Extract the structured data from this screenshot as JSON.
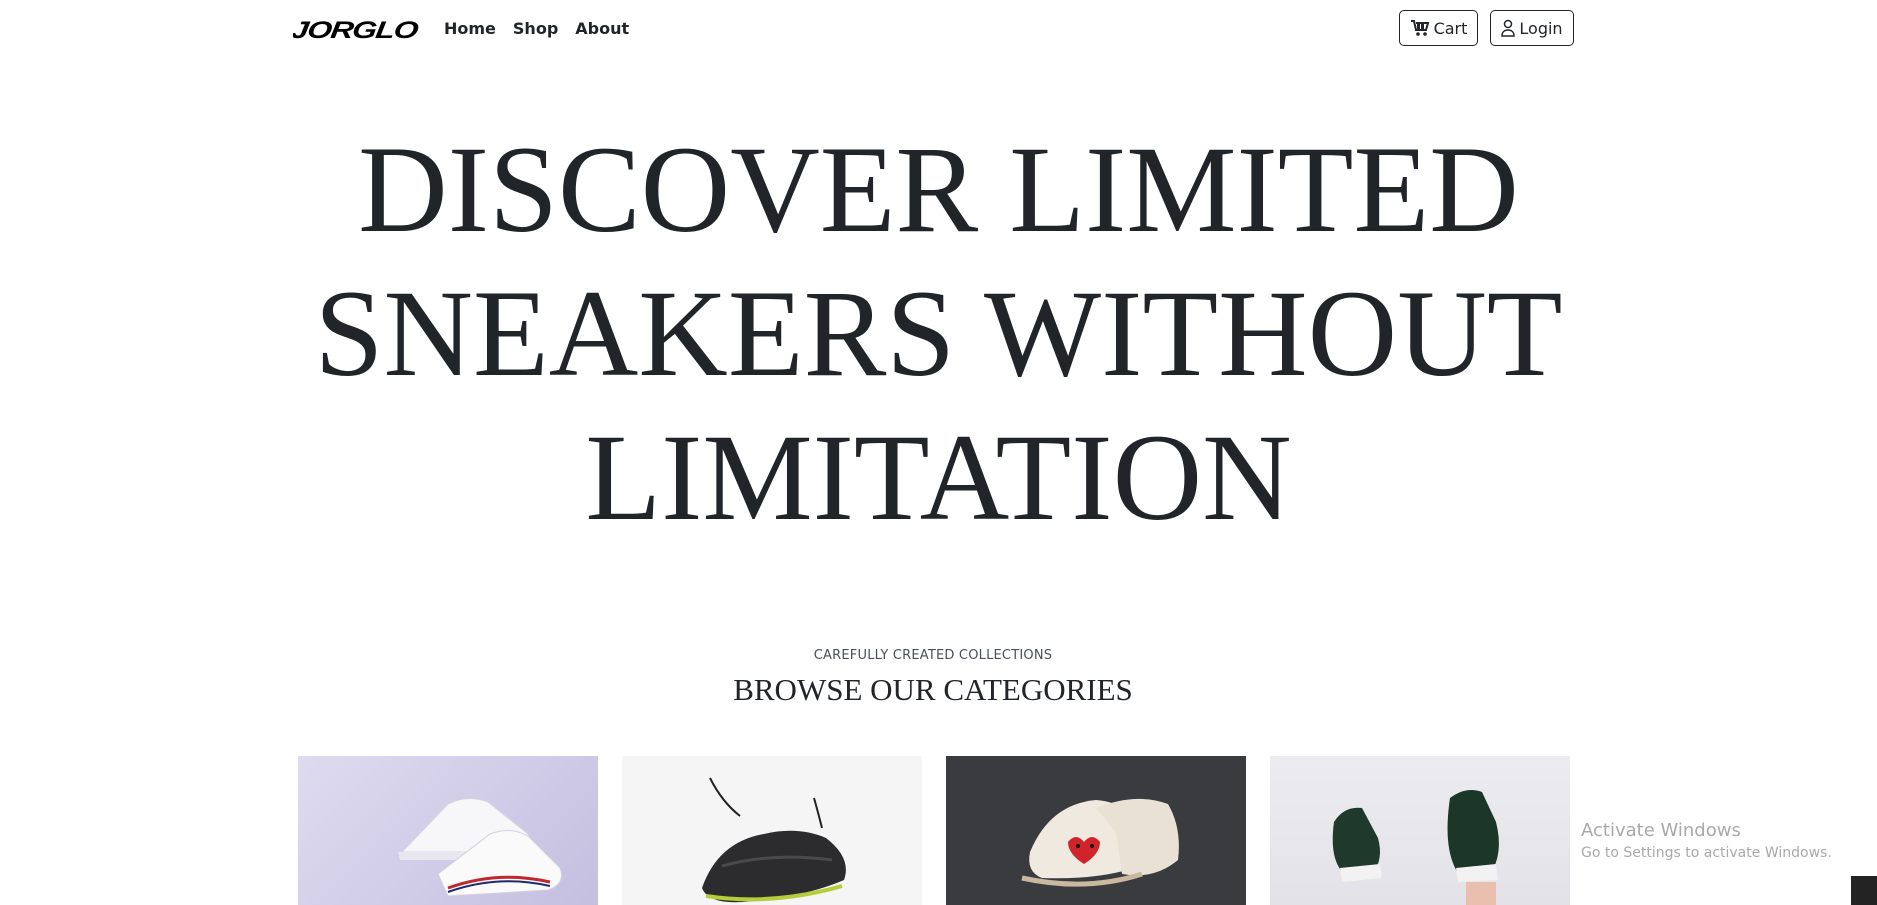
{
  "brand": {
    "logo_text": "JORGLO"
  },
  "nav": {
    "links": [
      {
        "label": "Home"
      },
      {
        "label": "Shop"
      },
      {
        "label": "About"
      }
    ],
    "cart_label": "Cart",
    "login_label": "Login",
    "icons": [
      "cart-icon",
      "user-icon"
    ]
  },
  "hero": {
    "lines": [
      "DISCOVER LIMITED",
      "SNEAKERS WITHOUT",
      "LIMITATION"
    ]
  },
  "categories": {
    "subtitle": "CAREFULLY CREATED COLLECTIONS",
    "title": "BROWSE OUR CATEGORIES",
    "cards": [
      {
        "image": "white-sneakers-photo",
        "bg": "#d6d2ea"
      },
      {
        "image": "black-running-shoe-photo",
        "bg": "#f5f5f5"
      },
      {
        "image": "heart-print-sneakers-photo",
        "bg": "#3a3b3e"
      },
      {
        "image": "green-high-tops-photo",
        "bg": "#e6e6eb"
      }
    ]
  },
  "system": {
    "watermark_title": "Activate Windows",
    "watermark_sub": "Go to Settings to activate Windows."
  },
  "colors": {
    "text": "#212529",
    "background": "#ffffff",
    "border": "#212529"
  }
}
